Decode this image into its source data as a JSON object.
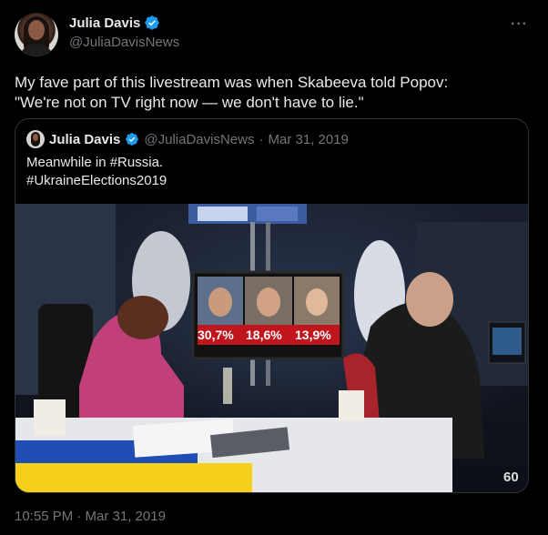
{
  "author": {
    "display_name": "Julia Davis",
    "handle": "@JuliaDavisNews",
    "verified_icon": "verified-badge-icon",
    "avatar_icon": "profile-avatar"
  },
  "tweet": {
    "line1": "My fave part of this livestream was when Skabeeva told Popov:",
    "line2": "\"We're not on TV right now — we don't have to lie.\"",
    "timestamp": "10:55 PM · Mar 31, 2019",
    "more_label": "···"
  },
  "quoted": {
    "display_name": "Julia Davis",
    "handle": "@JuliaDavisNews",
    "separator": "·",
    "date": "Mar 31, 2019",
    "line1": "Meanwhile in #Russia.",
    "line2": "#UkraineElections2019",
    "media": {
      "screen_percent_1": "30,7%",
      "screen_percent_2": "18,6%",
      "screen_percent_3": "13,9%",
      "channel_logo": "60"
    }
  },
  "colors": {
    "background": "#000000",
    "text_primary": "#e7e9ea",
    "text_secondary": "#71767b",
    "verified_blue": "#1d9bf0",
    "border": "#2f3336"
  }
}
